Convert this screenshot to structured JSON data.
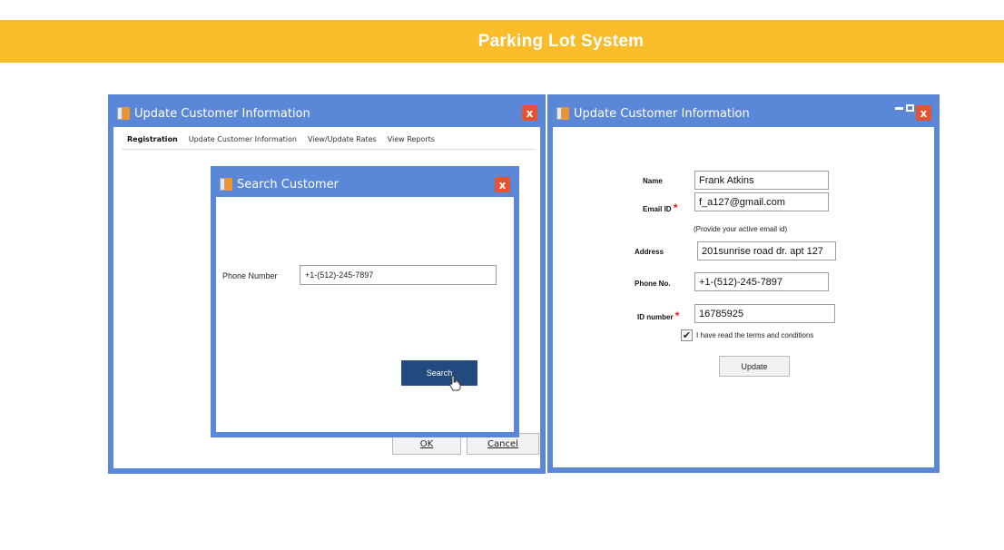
{
  "banner": {
    "title": "Parking Lot System"
  },
  "left_window": {
    "title": "Update Customer Information",
    "close": "x",
    "tabs": [
      {
        "label": "Registration"
      },
      {
        "label": "Update Customer Information"
      },
      {
        "label": "View/Update Rates"
      },
      {
        "label": "View Reports"
      }
    ],
    "ok_label": "OK",
    "cancel_label": "Cancel"
  },
  "search_dialog": {
    "title": "Search Customer",
    "close": "x",
    "phone_label": "Phone Number",
    "phone_value": "+1-(512)-245-7897",
    "search_label": "Search"
  },
  "right_window": {
    "title": "Update Customer Information",
    "close": "x",
    "name_label": "Name",
    "name_value": "Frank Atkins",
    "email_label": "Email ID",
    "email_value": "f_a127@gmail.com",
    "email_hint": "(Provide your active email id)",
    "address_label": "Address",
    "address_value": "201sunrise road dr. apt 127",
    "phone_label": "Phone No.",
    "phone_value": "+1-(512)-245-7897",
    "id_label": "ID  number",
    "id_value": "16785925",
    "required_mark": "*",
    "terms_checked": true,
    "terms_label": "I have read the terms and conditions",
    "update_label": "Update"
  },
  "colors": {
    "banner": "#fbbc2a",
    "window_frame": "#5b87d8",
    "close_button": "#e8532f",
    "primary_button": "#224a7e",
    "required": "#e02020"
  }
}
